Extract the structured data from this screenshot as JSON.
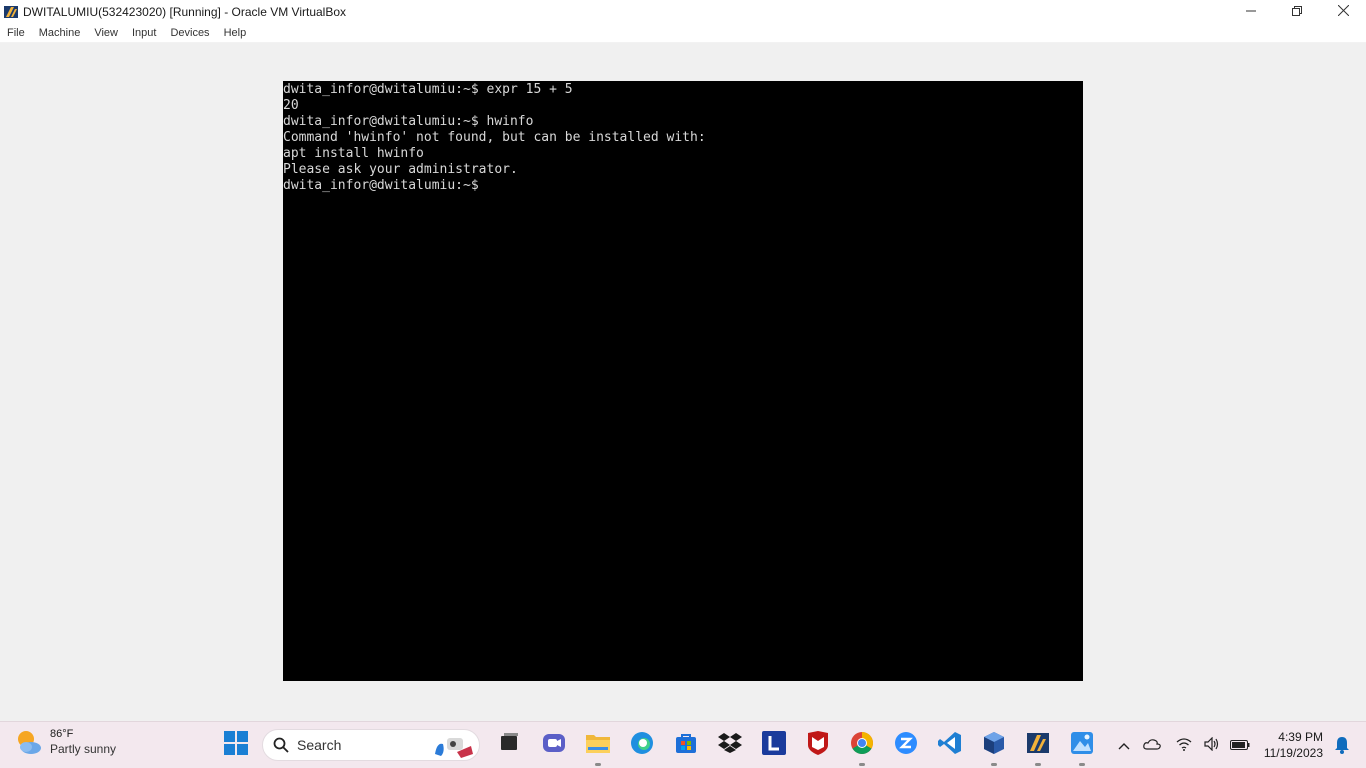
{
  "window": {
    "title": "DWITALUMIU(532423020) [Running] - Oracle VM VirtualBox",
    "minimize_icon": "minimize-icon",
    "restore_icon": "restore-icon",
    "close_icon": "close-icon"
  },
  "menu": {
    "items": [
      "File",
      "Machine",
      "View",
      "Input",
      "Devices",
      "Help"
    ]
  },
  "terminal": {
    "lines": [
      "dwita_infor@dwitalumiu:~$ expr 15 + 5",
      "20",
      "dwita_infor@dwitalumiu:~$ hwinfo",
      "Command 'hwinfo' not found, but can be installed with:",
      "apt install hwinfo",
      "Please ask your administrator.",
      "dwita_infor@dwitalumiu:~$ "
    ]
  },
  "taskbar": {
    "weather": {
      "temperature": "86°F",
      "description": "Partly sunny",
      "icon": "partly-sunny-icon"
    },
    "search": {
      "placeholder": "Search"
    },
    "apps": [
      "start-icon",
      "task-view-icon",
      "teams-meet-icon",
      "file-explorer-icon",
      "edge-icon",
      "microsoft-store-icon",
      "dropbox-icon",
      "l-app-icon",
      "mcafee-icon",
      "chrome-icon",
      "zoom-icon",
      "vscode-icon",
      "virtualbox-icon",
      "virtualbox-vm-icon",
      "photos-icon"
    ],
    "tray_icons": [
      "show-hidden-icons-icon",
      "onedrive-icon",
      "wifi-icon",
      "volume-icon",
      "battery-icon"
    ],
    "clock": {
      "time": "4:39 PM",
      "date": "11/19/2023"
    }
  },
  "colors": {
    "terminal_bg": "#000000",
    "terminal_fg": "#d8d8d8",
    "taskbar_bg": "#f3e8ee",
    "vm_backdrop": "#f0f0f0"
  }
}
